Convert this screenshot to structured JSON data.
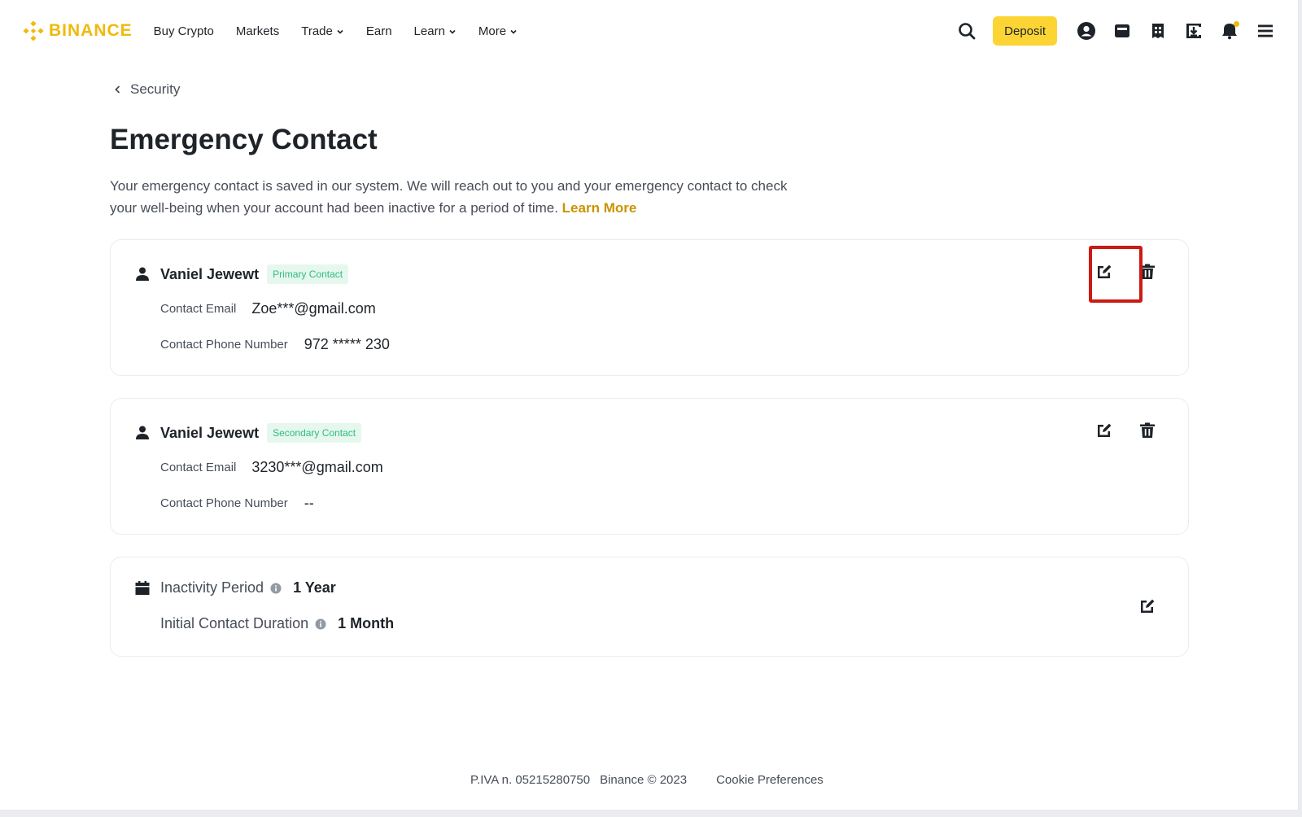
{
  "header": {
    "brand": "BINANCE",
    "nav": [
      {
        "label": "Buy Crypto",
        "chevron": false
      },
      {
        "label": "Markets",
        "chevron": false
      },
      {
        "label": "Trade",
        "chevron": true
      },
      {
        "label": "Earn",
        "chevron": false
      },
      {
        "label": "Learn",
        "chevron": true
      },
      {
        "label": "More",
        "chevron": true
      }
    ],
    "deposit_label": "Deposit",
    "icons": [
      "search-icon",
      "user-icon",
      "wallet-icon",
      "orders-icon",
      "download-icon",
      "bell-icon",
      "menu-icon"
    ]
  },
  "breadcrumb": {
    "label": "Security"
  },
  "page": {
    "title": "Emergency Contact",
    "description": "Your emergency contact is saved in our system. We will reach out to you and your emergency contact to check your well-being when your account had been inactive for a period of time.",
    "learn_more": "Learn More"
  },
  "contacts": [
    {
      "name": "Vaniel Jewewt",
      "badge": "Primary Contact",
      "email_label": "Contact Email",
      "email": "Zoe***@gmail.com",
      "phone_label": "Contact Phone Number",
      "phone": "972 ***** 230"
    },
    {
      "name": "Vaniel Jewewt",
      "badge": "Secondary Contact",
      "email_label": "Contact Email",
      "email": "3230***@gmail.com",
      "phone_label": "Contact Phone Number",
      "phone": "--"
    }
  ],
  "inactivity": {
    "period_label": "Inactivity Period",
    "period_value": "1 Year",
    "duration_label": "Initial Contact Duration",
    "duration_value": "1 Month"
  },
  "footer": {
    "piva": "P.IVA n. 05215280750",
    "copyright": "Binance © 2023",
    "cookie": "Cookie Preferences"
  },
  "colors": {
    "brand": "#f0b90b",
    "deposit_bg": "#fcd535",
    "badge_text": "#2ebd85",
    "badge_bg": "#e6f7ee",
    "highlight": "#c91b13",
    "link": "#c99400"
  }
}
